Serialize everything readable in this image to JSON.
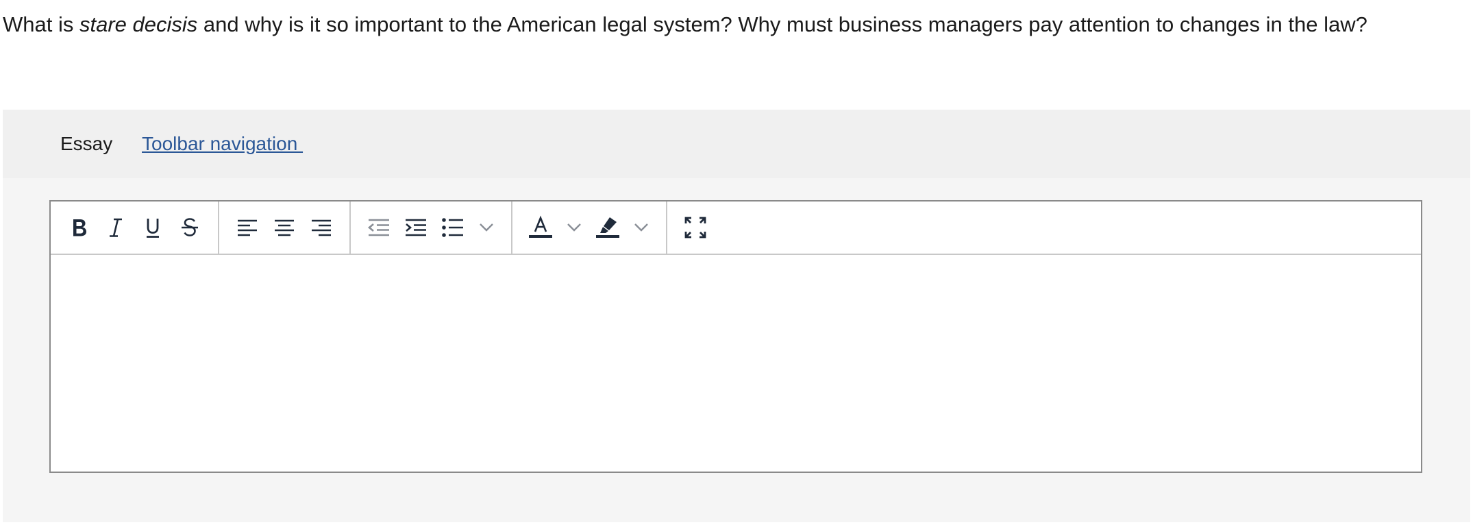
{
  "question": {
    "prefix": "What is ",
    "term": "stare decisis",
    "suffix": " and why is it so important to the American legal system? Why must business managers pay attention to changes in the law?"
  },
  "panel": {
    "label": "Essay",
    "toolbar_link": "Toolbar navigation "
  },
  "toolbar": {
    "groups": [
      [
        "bold-icon",
        "italic-icon",
        "underline-icon",
        "strikethrough-icon"
      ],
      [
        "align-left-icon",
        "align-center-icon",
        "align-right-icon"
      ],
      [
        "outdent-icon",
        "indent-icon",
        "bullet-list-icon",
        "chevron-down-icon"
      ],
      [
        "text-color-icon",
        "chevron-down-icon",
        "highlight-icon",
        "chevron-down-icon"
      ],
      [
        "fullscreen-icon"
      ]
    ]
  },
  "colors": {
    "icon": "#1f2a3a",
    "icon_disabled": "#8a8f97",
    "link": "#2b5797",
    "panel_bg": "#f5f5f5",
    "header_bg": "#f0f0f0",
    "editor_border": "#8a8a8a"
  },
  "editor": {
    "value": ""
  }
}
